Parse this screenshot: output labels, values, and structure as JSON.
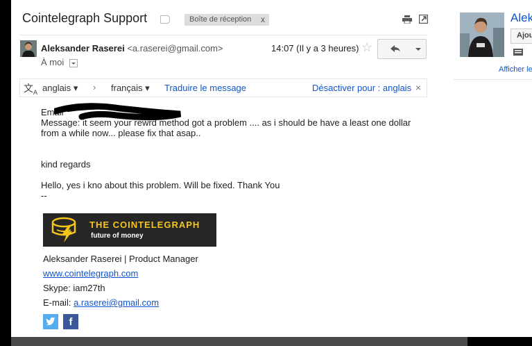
{
  "header": {
    "subject": "Cointelegraph Support",
    "label_chip": "Boîte de réception",
    "chip_close": "x"
  },
  "message": {
    "sender_name": "Aleksander Raserei",
    "sender_email": "<a.raserei@gmail.com>",
    "time": "14:07 (Il y a 3 heures)",
    "to": "À moi"
  },
  "translate": {
    "from": "anglais",
    "to": "français",
    "translate_link": "Traduire le message",
    "disable_link": "Désactiver pour : anglais",
    "close": "×"
  },
  "body": {
    "line_email": "Email",
    "line_message_1": "Message: it seem your rewrd method got a problem .... as i should be have a least one dollar",
    "line_message_2": "from a while now... please fix that asap..",
    "line_regards": "kind regards",
    "line_reply": "Hello, yes i kno about this problem. Will be fixed. Thank You",
    "line_dash": "--"
  },
  "logo": {
    "title": "THE COINTELEGRAPH",
    "subtitle": "future of money"
  },
  "signature": {
    "name_role": "Aleksander Raserei | Product Manager",
    "website": "www.cointelegraph.com",
    "skype": "Skype: iam27th",
    "email_label": "E-mail: ",
    "email": "a.raserei@gmail.com"
  },
  "side": {
    "name": "Alek",
    "add_button": "Ajou",
    "show_link": "Afficher le"
  },
  "icons": {
    "label": "label-icon",
    "print": "print-icon",
    "popout": "popout-icon",
    "star": "star-icon",
    "reply": "reply-icon",
    "more": "chevron-down-icon",
    "translate": "translate-icon",
    "twitter": "twitter-icon",
    "facebook": "facebook-icon"
  },
  "colors": {
    "link": "#1155cc",
    "logo_bg": "#262626",
    "logo_accent": "#f5c518",
    "twitter": "#55acee",
    "facebook": "#3b5998"
  }
}
